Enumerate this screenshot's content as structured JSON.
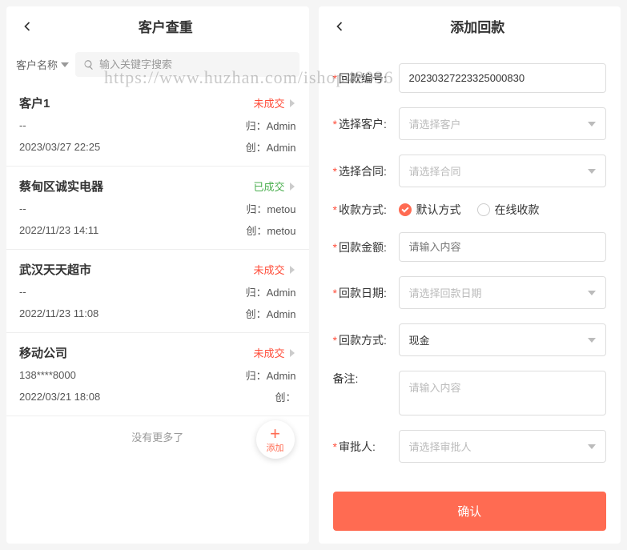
{
  "watermark": "https://www.huzhan.com/ishop42036",
  "left": {
    "title": "客户查重",
    "filter_label": "客户名称",
    "search_placeholder": "输入关键字搜索",
    "no_more": "没有更多了",
    "items": [
      {
        "name": "客户1",
        "status": "未成交",
        "status_type": "fail",
        "phone": "--",
        "owner_label": "归：Admin",
        "time": "2023/03/27 22:25",
        "creator_label": "创：Admin"
      },
      {
        "name": "蔡甸区诚实电器",
        "status": "已成交",
        "status_type": "ok",
        "phone": "--",
        "owner_label": "归：metou",
        "time": "2022/11/23 14:11",
        "creator_label": "创：metou"
      },
      {
        "name": "武汉天天超市",
        "status": "未成交",
        "status_type": "fail",
        "phone": "--",
        "owner_label": "归：Admin",
        "time": "2022/11/23 11:08",
        "creator_label": "创：Admin"
      },
      {
        "name": "移动公司",
        "status": "未成交",
        "status_type": "fail",
        "phone": "138****8000",
        "owner_label": "归：Admin",
        "time": "2022/03/21 18:08",
        "creator_label": "创："
      }
    ],
    "fab_label": "添加"
  },
  "right": {
    "title": "添加回款",
    "fields": {
      "number_label": "回款编号:",
      "number_value": "20230327223325000830",
      "customer_label": "选择客户:",
      "customer_placeholder": "请选择客户",
      "contract_label": "选择合同:",
      "contract_placeholder": "请选择合同",
      "paymethod_label": "收款方式:",
      "radio1": "默认方式",
      "radio2": "在线收款",
      "amount_label": "回款金额:",
      "amount_placeholder": "请输入内容",
      "date_label": "回款日期:",
      "date_placeholder": "请选择回款日期",
      "paytype_label": "回款方式:",
      "paytype_value": "现金",
      "remark_label": "备注:",
      "remark_placeholder": "请输入内容",
      "approver_label": "审批人:",
      "approver_placeholder": "请选择审批人"
    },
    "confirm": "确认"
  }
}
